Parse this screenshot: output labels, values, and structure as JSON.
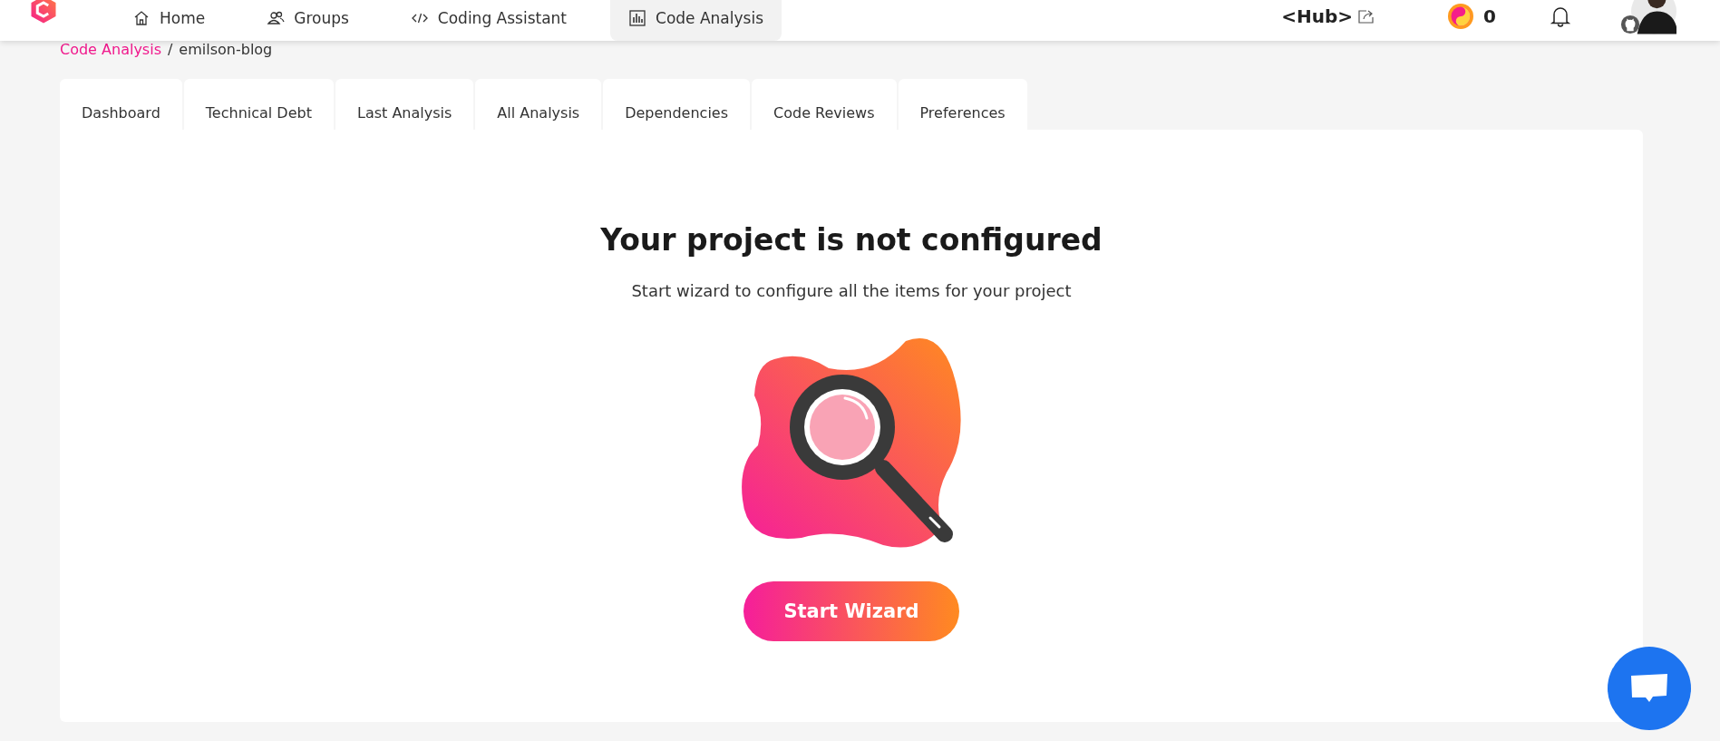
{
  "nav": {
    "items": [
      {
        "label": "Home",
        "selected": false
      },
      {
        "label": "Groups",
        "selected": false
      },
      {
        "label": "Coding Assistant",
        "selected": false
      },
      {
        "label": "Code Analysis",
        "selected": true
      }
    ],
    "hub": "<Hub>",
    "coins": "0"
  },
  "breadcrumb": {
    "link": "Code Analysis",
    "separator": "/",
    "current": "emilson-blog"
  },
  "tabs": [
    "Dashboard",
    "Technical Debt",
    "Last Analysis",
    "All Analysis",
    "Dependencies",
    "Code Reviews",
    "Preferences"
  ],
  "empty_state": {
    "title": "Your project is not configured",
    "subtitle": "Start wizard to configure all the items for your project",
    "button": "Start Wizard"
  }
}
